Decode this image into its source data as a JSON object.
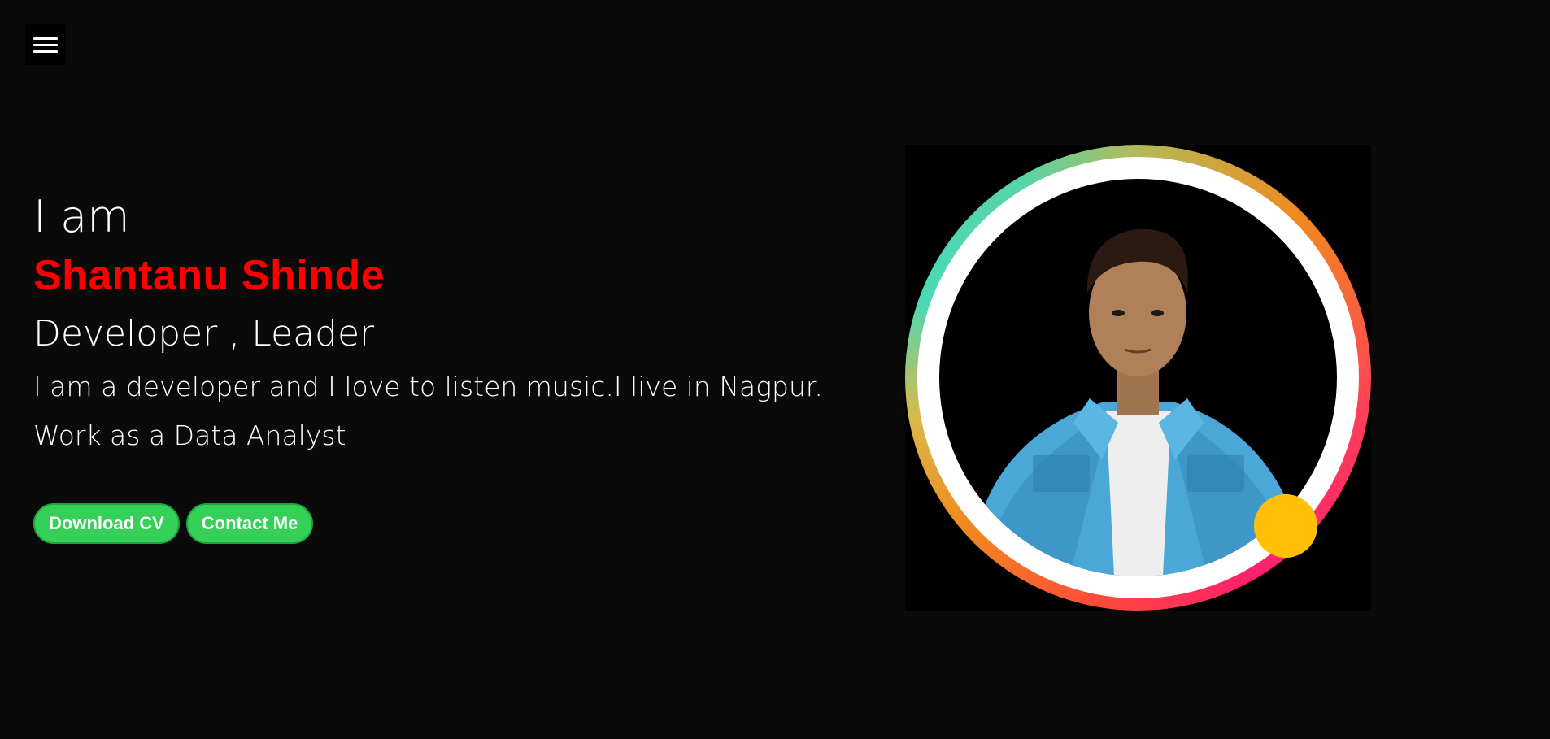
{
  "nav": {
    "menu_icon": "hamburger-menu-icon"
  },
  "hero": {
    "intro": "I am",
    "name": "Shantanu Shinde",
    "roles": "Developer , Leader",
    "bio_line1": "I am a developer and I love to listen music.I live in Nagpur.",
    "bio_line2": "Work as a Data Analyst"
  },
  "buttons": {
    "download_cv": "Download CV",
    "contact_me": "Contact Me"
  },
  "colors": {
    "background": "#0a0a0a",
    "name": "#ff0000",
    "button": "#34d058",
    "accent_dot": "#ffc107"
  }
}
